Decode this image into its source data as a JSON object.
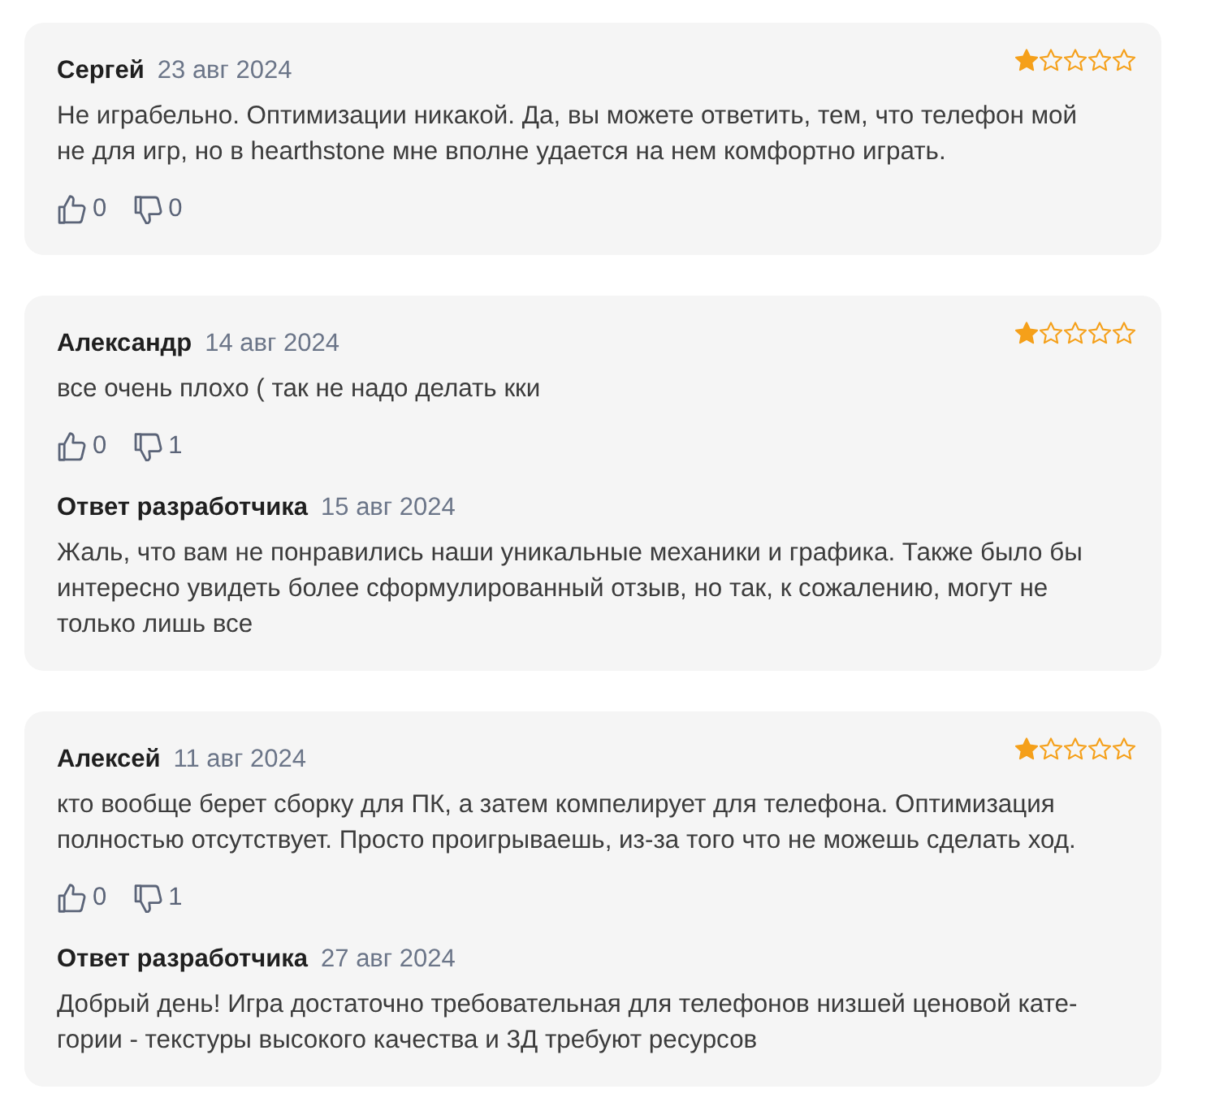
{
  "reviews": [
    {
      "author": "Сергей",
      "date": "23 авг 2024",
      "stars": 1,
      "text": "Не играбельно. Оптимизации никакой. Да, вы можете ответить, тем, что телефон мой не для игр, но в hearthstone мне вполне удается на нем комфортно играть.",
      "likes": "0",
      "dislikes": "0"
    },
    {
      "author": "Александр",
      "date": "14 авг 2024",
      "stars": 1,
      "text": "все очень плохо ( так не надо делать кки",
      "likes": "0",
      "dislikes": "1",
      "reply": {
        "title": "Ответ разработчика",
        "date": "15 авг 2024",
        "text": "Жаль, что вам не понравились наши уникальные механики и графика. Также было бы интересно увидеть более сформулированный отзыв, но так, к сожалению, могут не только лишь все"
      }
    },
    {
      "author": "Алексей",
      "date": "11 авг 2024",
      "stars": 1,
      "text": "кто вообще берет сборку для ПК, а затем компелирует для телефона. Оптимизация полностью отсутствует. Просто проигрываешь, из-за того что не можешь сделать ход.",
      "likes": "0",
      "dislikes": "1",
      "reply": {
        "title": "Ответ разработчика",
        "date": "27 авг 2024",
        "text": "Добрый день! Игра достаточно требовательная для телефонов низшей ценовой кате-гории - текстуры высокого качества и 3Д требуют ресурсов"
      }
    }
  ]
}
